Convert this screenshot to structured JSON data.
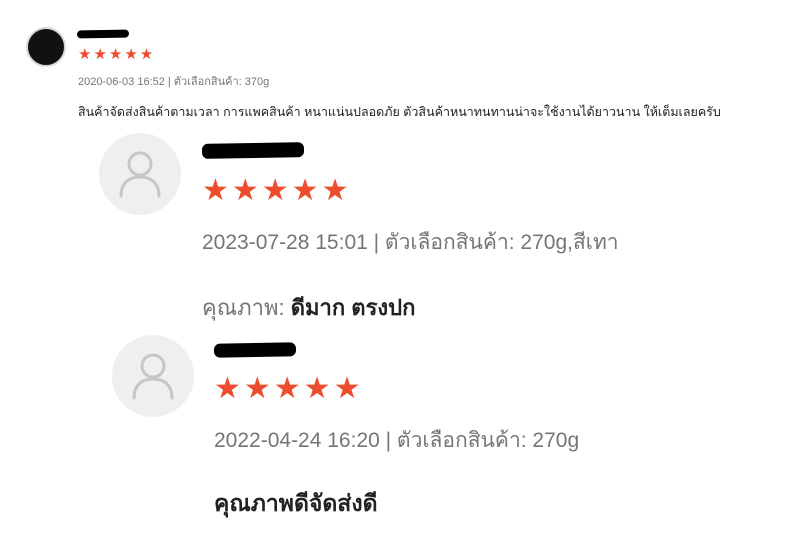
{
  "colors": {
    "star": "#ee4d2d",
    "meta_text": "#757575",
    "body_text": "#222222",
    "avatar_placeholder": "#efefef"
  },
  "reviews": [
    {
      "stars": "★★★★★",
      "meta": "2020-06-03 16:52 | ตัวเลือกสินค้า: 370g",
      "body": "สินค้าจัดส่งสินค้าตามเวลา การแพคสินค้า หนาแน่นปลอดภัย ตัวสินค้าหนาทนทานน่าจะใช้งานได้ยาวนาน ให้เต็มเลยครับ",
      "avatar_icon": "user-avatar-dark"
    },
    {
      "stars": "★★★★★",
      "meta": "2023-07-28 15:01 | ตัวเลือกสินค้า: 270g,สีเทา",
      "quality_label": "คุณภาพ:",
      "quality_value": "ดีมาก ตรงปก",
      "avatar_icon": "user-placeholder-icon"
    },
    {
      "stars": "★★★★★",
      "meta": "2022-04-24 16:20 | ตัวเลือกสินค้า: 270g",
      "body": "คุณภาพดีจัดส่งดี",
      "avatar_icon": "user-placeholder-icon"
    }
  ]
}
